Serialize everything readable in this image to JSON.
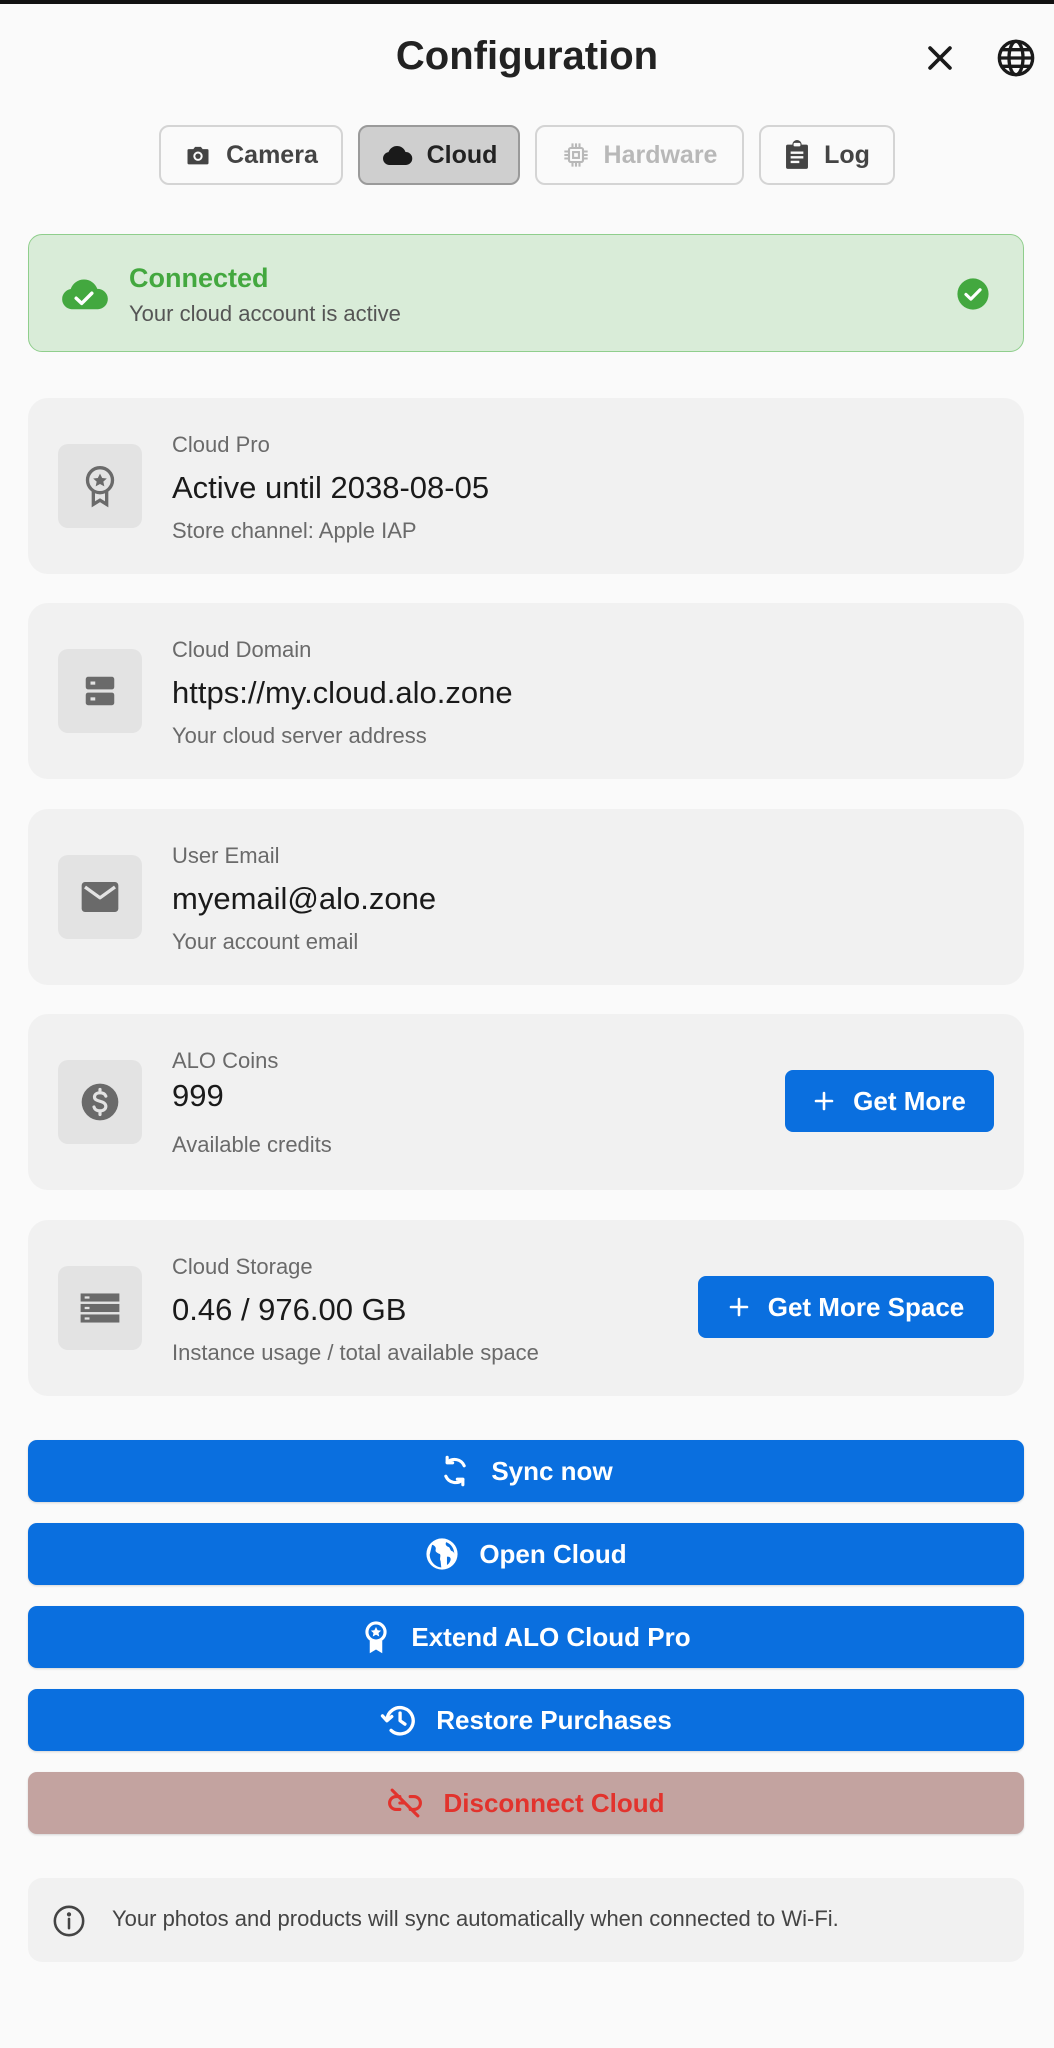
{
  "header": {
    "title": "Configuration",
    "close_icon": "close-icon",
    "language_icon": "globe-icon"
  },
  "tabs": [
    {
      "label": "Camera",
      "icon": "camera-icon",
      "state": "normal"
    },
    {
      "label": "Cloud",
      "icon": "cloud-icon",
      "state": "active"
    },
    {
      "label": "Hardware",
      "icon": "chip-icon",
      "state": "disabled"
    },
    {
      "label": "Log",
      "icon": "clipboard-icon",
      "state": "normal"
    }
  ],
  "status": {
    "title": "Connected",
    "subtitle": "Your cloud account is active",
    "color": "#43a83f"
  },
  "cards": {
    "pro": {
      "label": "Cloud Pro",
      "value": "Active until 2038-08-05",
      "sub": "Store channel: Apple IAP",
      "icon": "award-icon"
    },
    "domain": {
      "label": "Cloud Domain",
      "value": "https://my.cloud.alo.zone",
      "sub": "Your cloud server address",
      "icon": "server-icon"
    },
    "email": {
      "label": "User Email",
      "value": "myemail@alo.zone",
      "sub": "Your account email",
      "icon": "mail-icon"
    },
    "coins": {
      "label": "ALO Coins",
      "value": "999",
      "sub": "Available credits",
      "icon": "dollar-icon",
      "button": "Get More"
    },
    "storage": {
      "label": "Cloud Storage",
      "value": "0.46 / 976.00 GB",
      "sub": "Instance usage / total available space",
      "icon": "storage-icon",
      "button": "Get More Space"
    }
  },
  "actions": {
    "sync": "Sync now",
    "open": "Open Cloud",
    "extend": "Extend ALO Cloud Pro",
    "restore": "Restore Purchases",
    "disconnect": "Disconnect Cloud"
  },
  "info": {
    "text": "Your photos and products will sync automatically when connected to Wi-Fi.",
    "icon": "info-icon"
  },
  "colors": {
    "primary": "#0a6fdf",
    "success": "#43a83f",
    "danger": "#e2332d",
    "danger_bg": "#c3a3a0"
  }
}
